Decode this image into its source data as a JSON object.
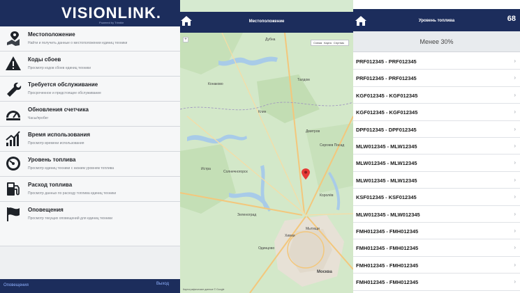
{
  "left_menu": {
    "logo": "VISIONLINK.",
    "logo_tag": "Powered by Trimble",
    "items": [
      {
        "title": "Местоположение",
        "desc": "Найти и получить данные о местоположении единиц техники",
        "icon": "location-pin-icon"
      },
      {
        "title": "Коды сбоев",
        "desc": "Просмотр кодов сбоев единиц техники",
        "icon": "warning-triangle-icon"
      },
      {
        "title": "Требуется обслуживание",
        "desc": "Просроченное и предстоящее обслуживание",
        "icon": "wrench-icon"
      },
      {
        "title": "Обновления счетчика",
        "desc": "Часы/пробег",
        "icon": "gauge-icon"
      },
      {
        "title": "Время использования",
        "desc": "Просмотр времени использования",
        "icon": "usage-chart-icon"
      },
      {
        "title": "Уровень топлива",
        "desc": "Просмотр единиц техники с низким уровнем топлива",
        "icon": "fuel-gauge-icon"
      },
      {
        "title": "Расход топлива",
        "desc": "Просмотр данных по расходу топлива единиц техники",
        "icon": "fuel-pump-icon"
      },
      {
        "title": "Оповещения",
        "desc": "Просмотр текущих оповещений для единиц техники",
        "icon": "flag-icon"
      }
    ],
    "footer_left": "Оповещения",
    "footer_right": "Выход"
  },
  "map": {
    "title": "Местоположение",
    "map_types": [
      "Схема",
      "Карта",
      "Спутник"
    ],
    "zoom_plus": "+",
    "zoom_minus": "−",
    "cities": [
      "Дубна",
      "Талдом",
      "Конаково",
      "Клин",
      "Дмитров",
      "Сергиев Посад",
      "Солнечногорск",
      "Истра",
      "Зеленоград",
      "Королёв",
      "Мытищи",
      "Одинцово",
      "Москва",
      "Химки"
    ],
    "copyright": "Картографические данные © Google"
  },
  "fuel_list": {
    "title": "Уровень топлива",
    "count": "68",
    "filter": "Менее 30%",
    "rows": [
      "PRF012345 - PRF012345",
      "PRF012345 - PRF012345",
      "KGF012345 - KGF012345",
      "KGF012345 - KGF012345",
      "DPF012345 - DPF012345",
      "MLW012345 - MLW12345",
      "MLW012345 - MLW12345",
      "MLW012345 - MLW12345",
      "KSF012345 - KSF012345",
      "MLW012345 - MLW012345",
      "FMH012345 - FMH012345",
      "FMH012345 - FMH012345",
      "FMH012345 - FMH012345",
      "FMH012345 - FMH012345"
    ]
  },
  "colors": {
    "header_bg": "#1c2d5c",
    "menu_bg": "#f6f7f8",
    "map_green": "#d6ead0",
    "marker": "#e53935"
  }
}
